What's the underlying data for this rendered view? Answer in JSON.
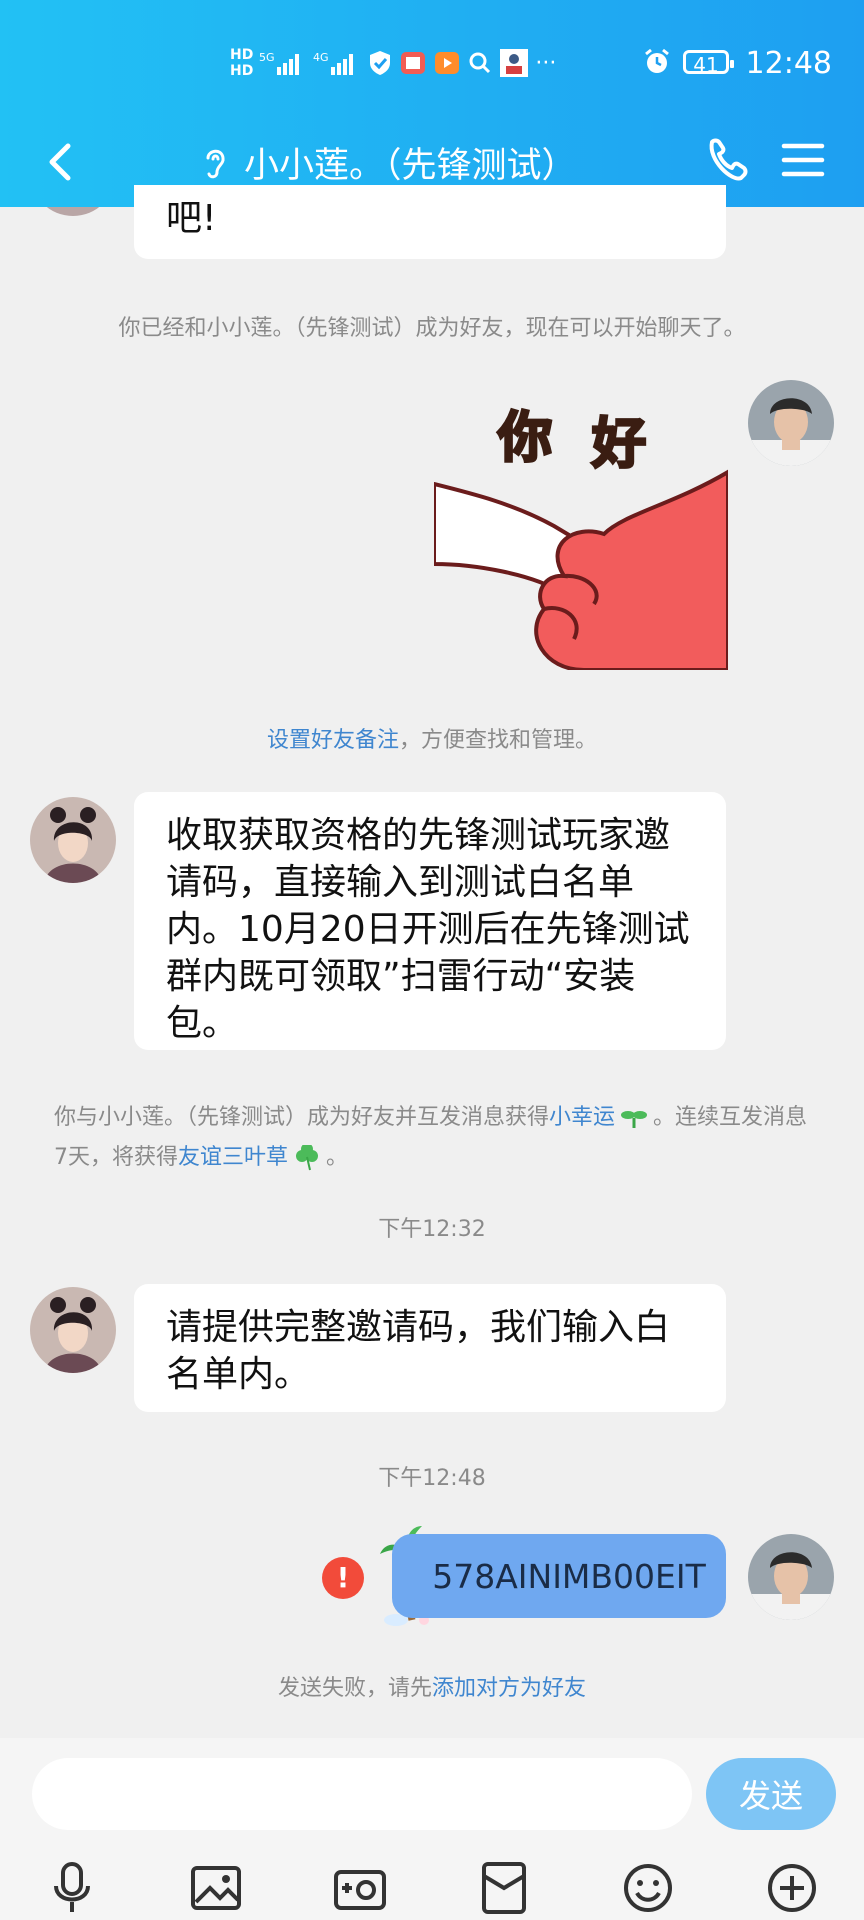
{
  "status_bar": {
    "time": "12:48",
    "battery": "41"
  },
  "header": {
    "title": "小小莲。（先锋测试）"
  },
  "messages": {
    "top_bubble_text": "吧!",
    "friend_added_notice": "你已经和小小莲。（先锋测试）成为好友，现在可以开始聊天了。",
    "sticker_text": "你 好",
    "remark_link": "设置好友备注",
    "remark_rest": "，方便查找和管理。",
    "bubble1": "收取获取资格的先锋测试玩家邀请码，直接输入到测试白名单内。10月20日开测后在先锋测试群内既可领取”扫雷行动“安装包。",
    "luck_prefix": "你与小小莲。（先锋测试）成为好友并互发消息获得",
    "luck_link1": "小幸运",
    "luck_mid": "。连续互发消息7天，将获得",
    "luck_link2": "友谊三叶草",
    "luck_end": "。",
    "time1": "下午12:32",
    "bubble2": "请提供完整邀请码，我们输入白名单内。",
    "time2": "下午12:48",
    "my_message": "578AINIMB00EIT",
    "fail_prefix": "发送失败，请先",
    "fail_link": "添加对方为好友"
  },
  "input": {
    "send_label": "发送"
  },
  "colors": {
    "header_start": "#22c1f4",
    "header_end": "#1e9ff1",
    "link": "#3f86cf",
    "my_bubble": "#6fa8f0",
    "error": "#f24b3a"
  }
}
